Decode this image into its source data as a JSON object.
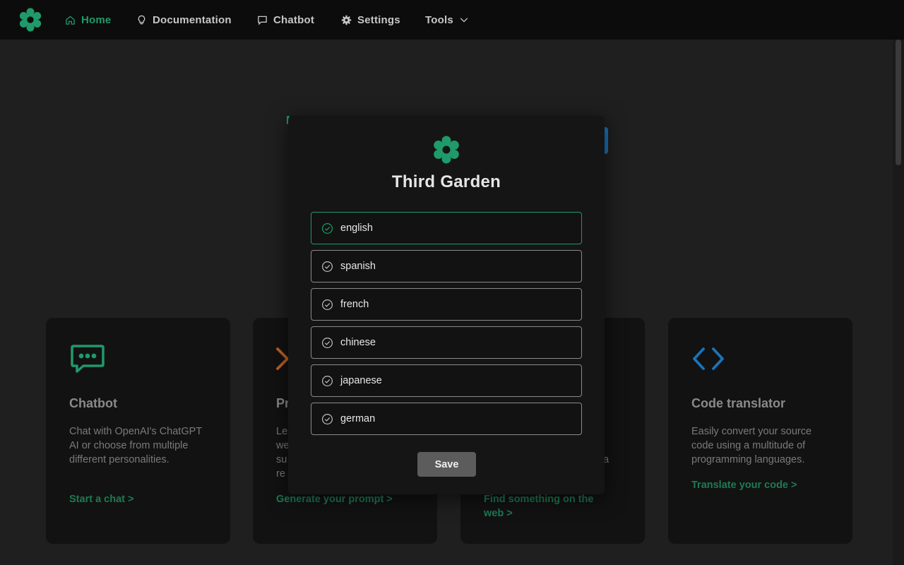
{
  "colors": {
    "accent": "#1f9a6b",
    "nav_background": "#0c0c0c",
    "page_background": "#1f1f1f",
    "card_background": "#121212",
    "modal_background": "#151515",
    "prompt_icon": "#c0612a",
    "code_icon": "#1a73b8"
  },
  "nav": {
    "logo_icon": "flower-logo-icon",
    "items": [
      {
        "label": "Home",
        "icon": "home-icon",
        "active": true
      },
      {
        "label": "Documentation",
        "icon": "lightbulb-icon"
      },
      {
        "label": "Chatbot",
        "icon": "chat-bubble-icon"
      },
      {
        "label": "Settings",
        "icon": "gear-icon"
      },
      {
        "label": "Tools",
        "icon": "chevron-down-icon"
      }
    ]
  },
  "cards": [
    {
      "icon": "chat-dots-icon",
      "title": "Chatbot",
      "description": "Chat with OpenAI's ChatGPT AI or choose from multiple different personalities.",
      "link": "Start a chat >"
    },
    {
      "icon": "chevron-right-icon",
      "title": "Pr",
      "description": "Le we su re",
      "link": "Generate your prompt >"
    },
    {
      "icon": "",
      "title": "",
      "description": "g a",
      "link": "Find something on the web >"
    },
    {
      "icon": "code-brackets-icon",
      "title": "Code translator",
      "description": "Easily convert your source code using a multitude of programming languages.",
      "link": "Translate your code >"
    }
  ],
  "modal": {
    "logo_icon": "flower-logo-icon",
    "title": "Third Garden",
    "languages": [
      {
        "label": "english",
        "selected": true
      },
      {
        "label": "spanish",
        "selected": false
      },
      {
        "label": "french",
        "selected": false
      },
      {
        "label": "chinese",
        "selected": false
      },
      {
        "label": "japanese",
        "selected": false
      },
      {
        "label": "german",
        "selected": false
      }
    ],
    "save_label": "Save"
  }
}
